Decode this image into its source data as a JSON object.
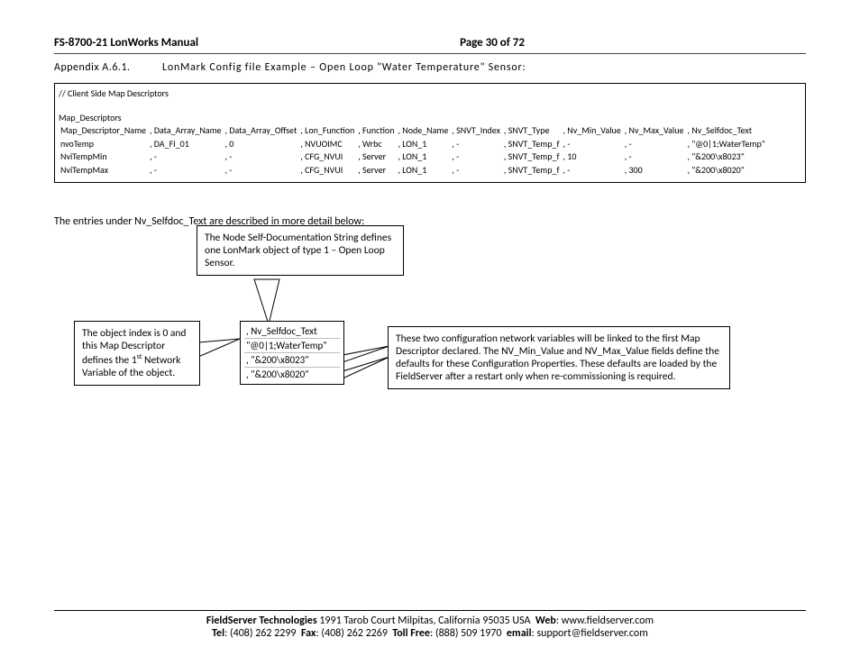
{
  "header": {
    "manual": "FS-8700-21 LonWorks Manual",
    "page": "Page 30 of 72"
  },
  "section": {
    "appendix": "Appendix A.6.1.",
    "title": "LonMark Config file Example – Open Loop \"Water Temperature\" Sensor:"
  },
  "config_comment": "//    Client Side Map Descriptors",
  "table_label": "Map_Descriptors",
  "columns": [
    "Map_Descriptor_Name",
    "Data_Array_Name",
    "Data_Array_Offset",
    "Lon_Function",
    "Function",
    "Node_Name",
    "SNVT_Index",
    "SNVT_Type",
    "Nv_Min_Value",
    "Nv_Max_Value",
    "Nv_Selfdoc_Text"
  ],
  "rows": [
    [
      "nvoTemp",
      ", DA_FI_01",
      ", 0",
      ", NVUOIMC",
      ", Wrbc",
      ", LON_1",
      ", -",
      ", SNVT_Temp_f",
      ", -",
      ", -",
      ", \"@0|1;WaterTemp\""
    ],
    [
      "NviTempMin",
      ", -",
      ", -",
      ", CFG_NVUI",
      ", Server",
      ", LON_1",
      ", -",
      ", SNVT_Temp_f",
      ", 10",
      ", -",
      ", \"&200\\x8023\""
    ],
    [
      "NviTempMax",
      ", -",
      ", -",
      ", CFG_NVUI",
      ", Server",
      ", LON_1",
      ", -",
      ", SNVT_Temp_f",
      ", -",
      ", 300",
      ", \"&200\\x8020\""
    ]
  ],
  "intro": "The entries under Nv_Selfdoc_Text are described in more detail below:",
  "callouts": {
    "top": "The Node Self-Documentation String defines one LonMark object of type 1 – Open Loop Sensor.",
    "left_html": "The object index is 0 and this Map Descriptor defines the 1<sup>st</sup> Network Variable of the object.",
    "right": "These two configuration network variables will be linked to the first Map Descriptor declared. The NV_Min_Value and NV_Max_Value fields define the defaults for these Configuration Properties. These defaults are loaded by the FieldServer after a restart only when re-commissioning is required."
  },
  "codebox": {
    "l1": ", Nv_Selfdoc_Text",
    "l2": "\"@0|1;WaterTemp\"",
    "l3": ", \"&200\\x8023\"",
    "l4": ", \"&200\\x8020\""
  },
  "footer": {
    "line1_html": "<b>FieldServer Technologies</b> 1991 Tarob Court Milpitas, California 95035 USA &nbsp;<b>Web</b>: www.fieldserver.com",
    "line2_html": "<b>Tel</b>: (408) 262 2299 &nbsp;<b>Fax</b>: (408) 262 2269 &nbsp;<b>Toll Free</b>: (888) 509 1970 &nbsp;<b>email</b>: support@fieldserver.com"
  }
}
